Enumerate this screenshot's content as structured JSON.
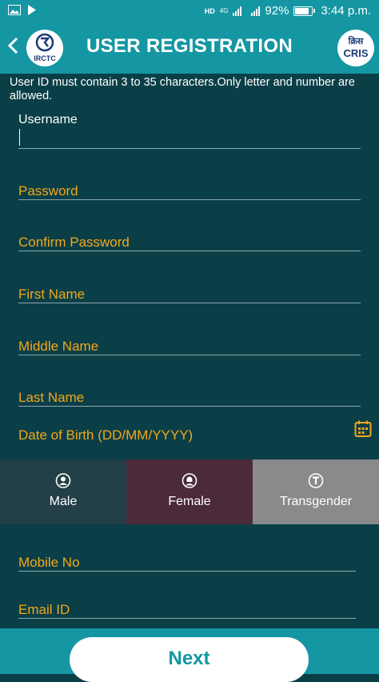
{
  "status_bar": {
    "network_label": "4G",
    "hd_label": "HD",
    "battery": "92%",
    "battery_level": 0.92,
    "time": "3:44 p.m."
  },
  "app_bar": {
    "title": "USER REGISTRATION",
    "left_logo_text": "IRCTC",
    "right_logo_text_hi": "क्रिस",
    "right_logo_text_en": "CRIS"
  },
  "form": {
    "hint": "User ID must contain 3 to 35 characters.Only letter and number are allowed.",
    "username_label": "Username",
    "password_label": "Password",
    "confirm_password_label": "Confirm Password",
    "first_name_label": "First Name",
    "middle_name_label": "Middle Name",
    "last_name_label": "Last Name",
    "dob_label": "Date of Birth (DD/MM/YYYY)",
    "mobile_label": "Mobile No",
    "email_label": "Email ID"
  },
  "gender": {
    "male": "Male",
    "female": "Female",
    "transgender": "Transgender"
  },
  "footer": {
    "next_label": "Next"
  },
  "colors": {
    "accent": "#1596a3",
    "background": "#0b3f47",
    "label": "#f2a71a"
  },
  "icons": [
    "image-icon",
    "play-icon",
    "signal-icon",
    "battery-icon",
    "back-chevron-icon",
    "calendar-icon",
    "user-icon",
    "female-icon",
    "transgender-icon"
  ]
}
